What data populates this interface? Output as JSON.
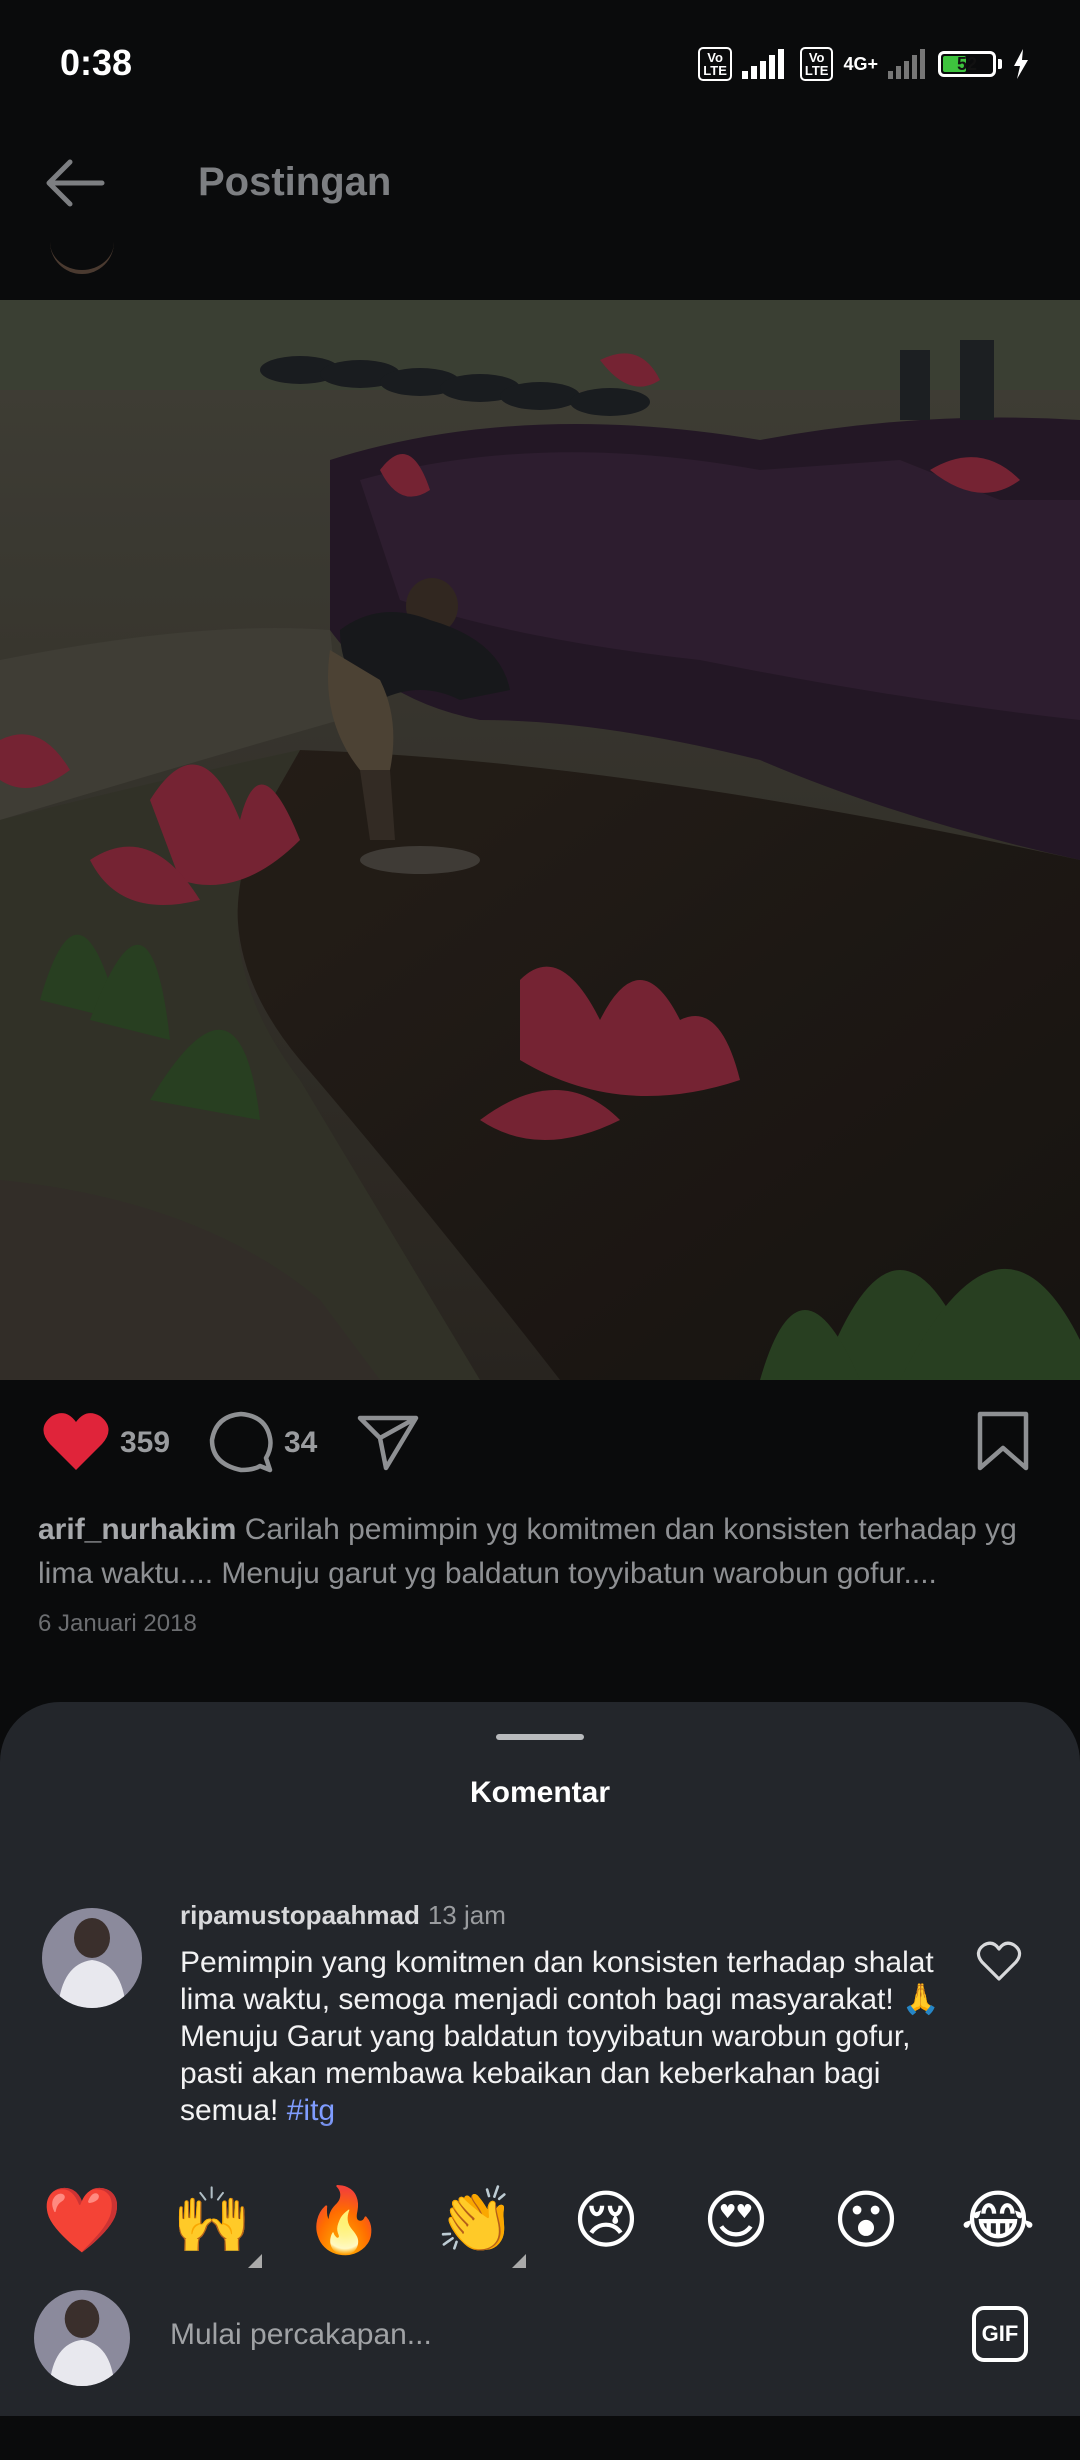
{
  "status_bar": {
    "time": "0:38",
    "volte_label": "Vo LTE",
    "network_label": "4G+",
    "battery_level": "52",
    "battery_fraction": 0.52
  },
  "header": {
    "back_icon": "arrow-left-icon",
    "title": "Postingan"
  },
  "post": {
    "like_count": "359",
    "comment_count": "34",
    "username": "arif_nurhakim",
    "caption": "Carilah pemimpin yg komitmen dan konsisten terhadap yg lima waktu.... Menuju garut yg baldatun toyyibatun warobun gofur....",
    "date": "6 Januari 2018"
  },
  "comments_sheet": {
    "title": "Komentar",
    "comment": {
      "username": "ripamustopaahmad",
      "time": "13 jam",
      "text": "Pemimpin yang komitmen dan konsisten terhadap shalat lima waktu, semoga menjadi contoh bagi masyarakat! 🙏 Menuju Garut yang baldatun toyyibatun warobun gofur, pasti akan membawa kebaikan dan keberkahan bagi semua!",
      "hashtag": "#itg"
    },
    "emojis": [
      "❤️",
      "🙌",
      "🔥",
      "👏",
      "😢",
      "😍",
      "😮",
      "😂"
    ],
    "composer_placeholder": "Mulai percakapan...",
    "gif_label": "GIF"
  },
  "colors": {
    "background": "#0a0b0c",
    "sheet": "#23262b",
    "like_red": "#e0243a",
    "hashtag": "#7f9cff"
  }
}
